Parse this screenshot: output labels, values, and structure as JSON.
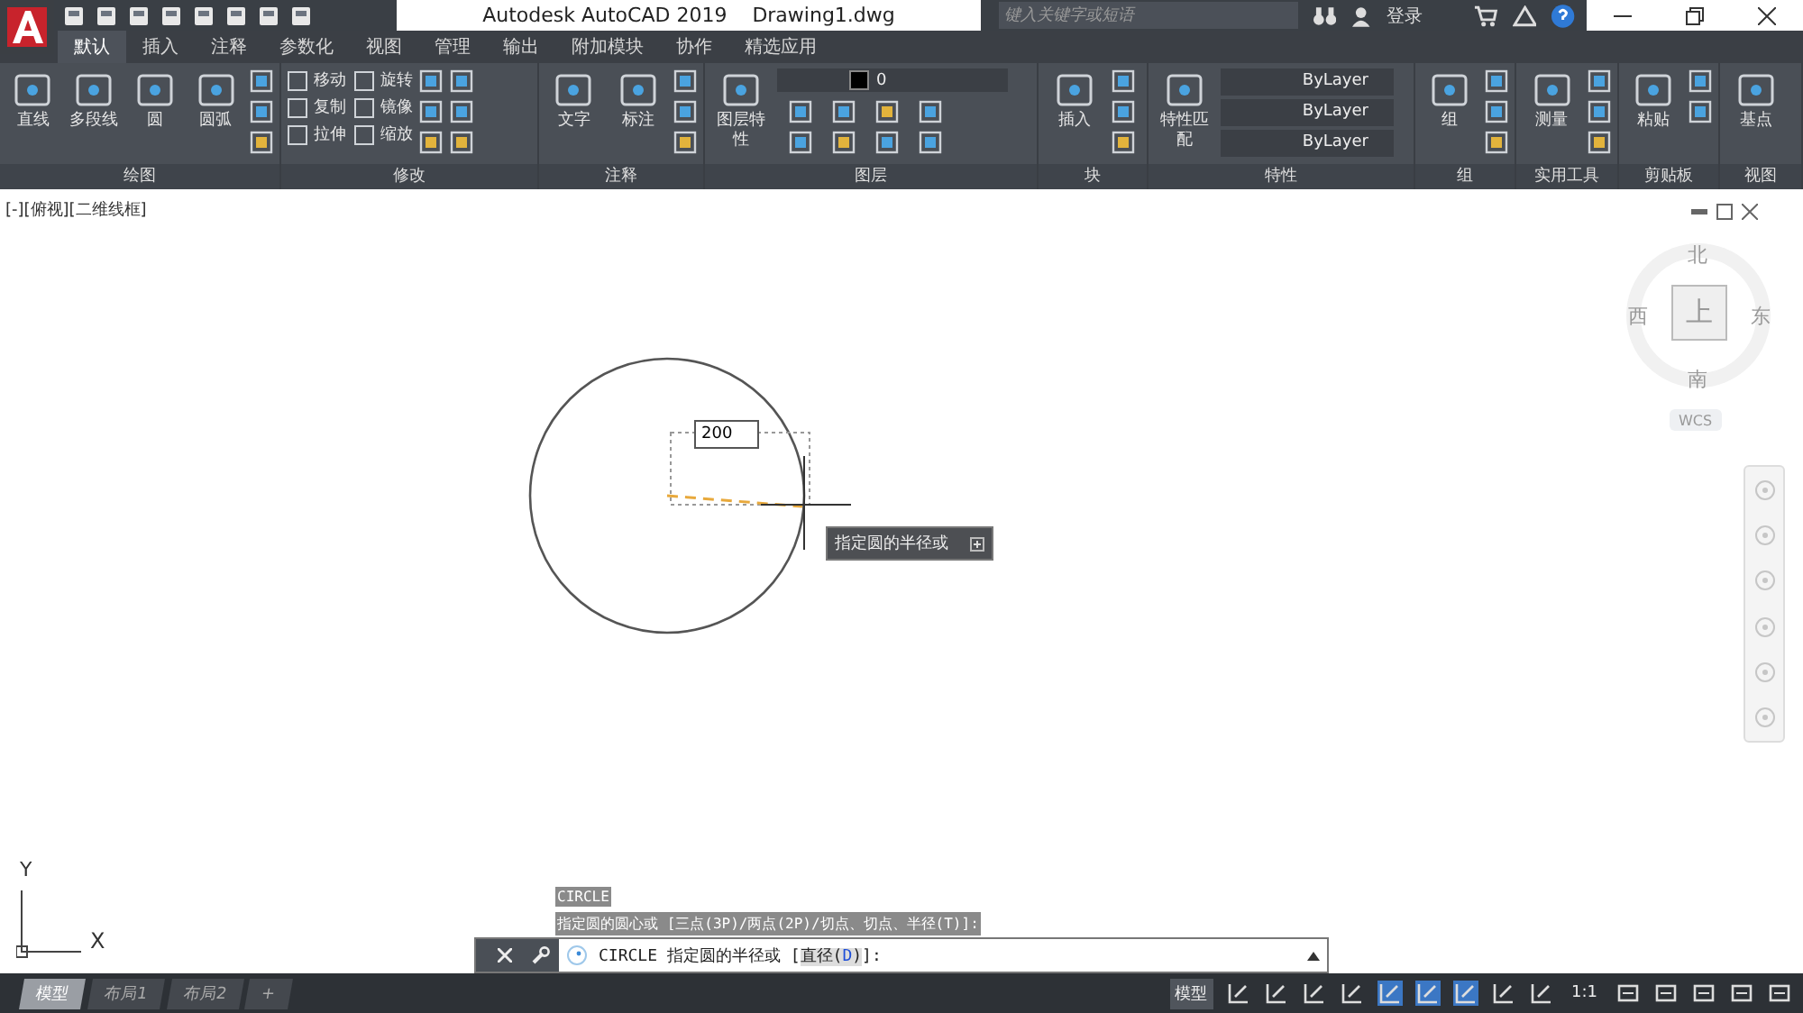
{
  "window": {
    "title": "Autodesk AutoCAD 2019",
    "document": "Drawing1.dwg"
  },
  "search": {
    "placeholder": "键入关键字或短语"
  },
  "user": {
    "label": "登录"
  },
  "tabs": [
    {
      "label": "默认",
      "selected": true
    },
    {
      "label": "插入",
      "selected": false
    },
    {
      "label": "注释",
      "selected": false
    },
    {
      "label": "参数化",
      "selected": false
    },
    {
      "label": "视图",
      "selected": false
    },
    {
      "label": "管理",
      "selected": false
    },
    {
      "label": "输出",
      "selected": false
    },
    {
      "label": "附加模块",
      "selected": false
    },
    {
      "label": "协作",
      "selected": false
    },
    {
      "label": "精选应用",
      "selected": false
    }
  ],
  "panels": [
    {
      "title": "绘图",
      "large": [
        "直线",
        "多段线",
        "圆",
        "圆弧"
      ]
    },
    {
      "title": "修改",
      "small": [
        "移动",
        "旋转",
        "复制",
        "镜像",
        "拉伸",
        "缩放"
      ]
    },
    {
      "title": "注释",
      "large": [
        "文字",
        "标注"
      ]
    },
    {
      "title": "图层",
      "large": [
        "图层特性"
      ],
      "layer": "0"
    },
    {
      "title": "块",
      "large": [
        "插入"
      ]
    },
    {
      "title": "特性",
      "large": [
        "特性匹配"
      ],
      "dropdowns": [
        "ByLayer",
        "ByLayer",
        "ByLayer"
      ]
    },
    {
      "title": "组",
      "large": [
        "组"
      ]
    },
    {
      "title": "实用工具",
      "large": [
        "测量"
      ]
    },
    {
      "title": "剪贴板",
      "large": [
        "粘贴"
      ]
    },
    {
      "title": "视图",
      "large": [
        "基点"
      ]
    }
  ],
  "viewport": {
    "label": "[-][俯视][二维线框]"
  },
  "viewcube": {
    "north": "北",
    "west": "西",
    "top": "上",
    "east": "东",
    "south": "南",
    "ucs": "WCS"
  },
  "dynamic_input": {
    "value": "200",
    "tooltip": "指定圆的半径或"
  },
  "ucs_icon": {
    "x": "X",
    "y": "Y"
  },
  "command_history": [
    "CIRCLE",
    "指定圆的圆心或 [三点(3P)/两点(2P)/切点、切点、半径(T)]:"
  ],
  "command_line": {
    "prompt": "CIRCLE 指定圆的半径或 [",
    "option": "直径(",
    "option_key": "D",
    "option_end": ")",
    "end": "]:"
  },
  "layout_tabs": [
    {
      "label": "模型",
      "selected": true
    },
    {
      "label": "布局1",
      "selected": false
    },
    {
      "label": "布局2",
      "selected": false
    },
    {
      "label": "+",
      "selected": false
    }
  ],
  "status_bar": {
    "space": "模型",
    "scale": "1:1"
  }
}
